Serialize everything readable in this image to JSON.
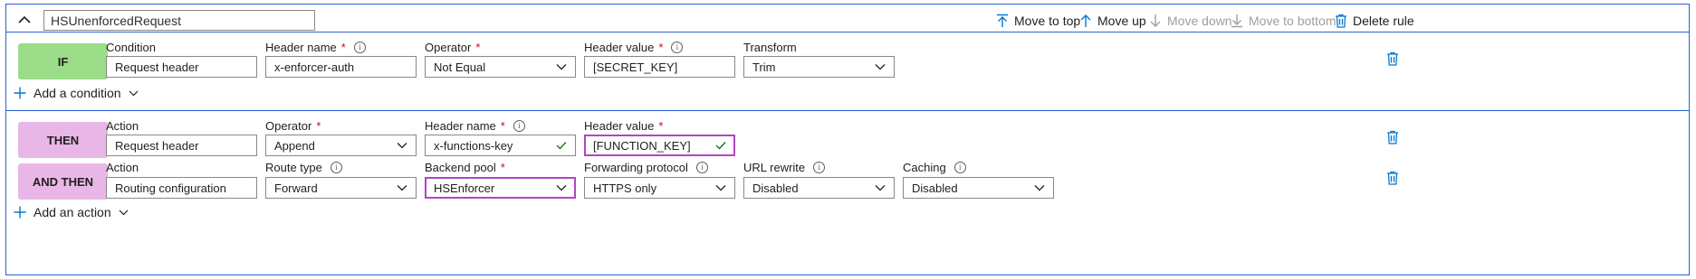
{
  "rule": {
    "name": "HSUnenforcedRequest"
  },
  "toolbar": {
    "move_to_top": "Move to top",
    "move_up": "Move up",
    "move_down": "Move down",
    "move_to_bottom": "Move to bottom",
    "delete_rule": "Delete rule"
  },
  "condition": {
    "badge": "IF",
    "labels": {
      "condition": "Condition",
      "header_name": "Header name",
      "operator": "Operator",
      "header_value": "Header value",
      "transform": "Transform"
    },
    "values": {
      "condition": "Request header",
      "header_name": "x-enforcer-auth",
      "operator": "Not Equal",
      "header_value": "[SECRET_KEY]",
      "transform": "Trim"
    },
    "add_label": "Add a condition"
  },
  "then_action": {
    "badge": "THEN",
    "labels": {
      "action": "Action",
      "operator": "Operator",
      "header_name": "Header name",
      "header_value": "Header value"
    },
    "values": {
      "action": "Request header",
      "operator": "Append",
      "header_name": "x-functions-key",
      "header_value": "[FUNCTION_KEY]"
    }
  },
  "and_then_action": {
    "badge": "AND THEN",
    "labels": {
      "action": "Action",
      "route_type": "Route type",
      "backend_pool": "Backend pool",
      "forwarding_protocol": "Forwarding protocol",
      "url_rewrite": "URL rewrite",
      "caching": "Caching"
    },
    "values": {
      "action": "Routing configuration",
      "route_type": "Forward",
      "backend_pool": "HSEnforcer",
      "forwarding_protocol": "HTTPS only",
      "url_rewrite": "Disabled",
      "caching": "Disabled"
    },
    "add_label": "Add an action"
  },
  "colors": {
    "if_badge": "#9bdc88",
    "then_badge": "#e9b6e8",
    "accent": "#0078d4",
    "frame": "#2b5fd6",
    "focus_border": "#b146c2",
    "success_check": "#107c10"
  },
  "icons": {
    "collapse": "chevron-up-icon",
    "move_to_top": "arrow-up-to-line-icon",
    "move_up": "arrow-up-icon",
    "move_down": "arrow-down-icon",
    "move_to_bottom": "arrow-down-to-line-icon",
    "delete": "trash-icon",
    "dropdown": "chevron-down-icon",
    "info": "info-icon",
    "add": "plus-icon",
    "valid": "checkmark-icon"
  }
}
